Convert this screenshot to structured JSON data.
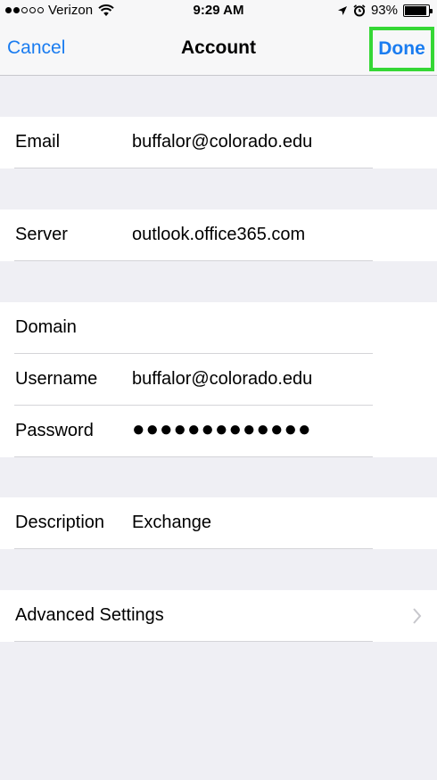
{
  "status_bar": {
    "carrier": "Verizon",
    "time": "9:29 AM",
    "battery_text": "93%",
    "battery_level": 0.93
  },
  "nav": {
    "cancel_label": "Cancel",
    "title": "Account",
    "done_label": "Done"
  },
  "account": {
    "email_label": "Email",
    "email_value": "buffalor@colorado.edu",
    "server_label": "Server",
    "server_value": "outlook.office365.com",
    "domain_label": "Domain",
    "domain_value": "",
    "username_label": "Username",
    "username_value": "buffalor@colorado.edu",
    "password_label": "Password",
    "password_value": "●●●●●●●●●●●●●",
    "description_label": "Description",
    "description_value": "Exchange",
    "advanced_label": "Advanced Settings"
  },
  "colors": {
    "accent": "#1a7cf0",
    "highlight": "#35d735",
    "background": "#efeff4"
  }
}
